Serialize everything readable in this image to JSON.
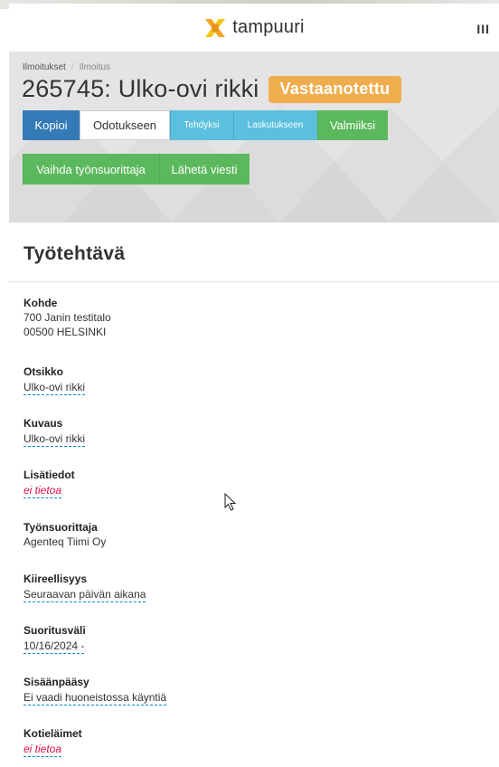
{
  "header": {
    "logo_text": "tampuuri",
    "menu_glyph": "III",
    "logo_colors": [
      "#f5a623",
      "#f0c419"
    ]
  },
  "breadcrumb": {
    "items": [
      "Ilmoitukset",
      "Ilmoitus"
    ]
  },
  "page": {
    "title": "265745: Ulko-ovi rikki",
    "status": "Vastaanotettu",
    "status_color": "#f0ad4e"
  },
  "actions": {
    "row1": [
      "Kopioi",
      "Odotukseen",
      "Tehdyksi",
      "Laskutukseen",
      "Valmiiksi"
    ],
    "row2": [
      "Vaihda työnsuorittaja",
      "Lähetä viesti"
    ]
  },
  "section": {
    "title": "Työtehtävä"
  },
  "fields": [
    {
      "label": "Kohde",
      "lines": [
        "700 Janin testitalo",
        "00500 HELSINKI"
      ]
    },
    {
      "label": "Otsikko",
      "value": "Ulko-ovi rikki"
    },
    {
      "label": "Kuvaus",
      "value": "Ulko-ovi rikki"
    },
    {
      "label": "Lisätiedot",
      "value": "ei tietoa"
    },
    {
      "label": "Työnsuorittaja",
      "value": "Agenteq Tiimi Oy"
    },
    {
      "label": "Kiireellisyys",
      "value": "Seuraavan päivän aikana"
    },
    {
      "label": "Suoritusväli",
      "value": "10/16/2024 -"
    },
    {
      "label": "Sisäänpääsy",
      "value": "Ei vaadi huoneistossa käyntiä"
    },
    {
      "label": "Kotieläimet",
      "value": "ei tietoa"
    }
  ]
}
